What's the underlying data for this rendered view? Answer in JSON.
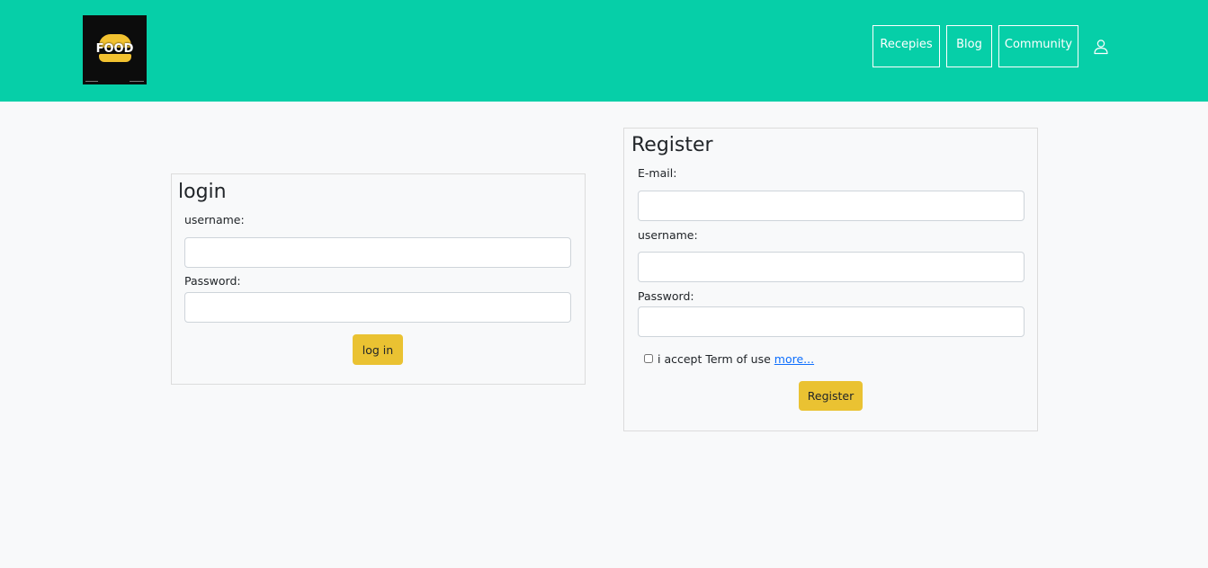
{
  "header": {
    "logo": {
      "text": "FOOD",
      "icon": "burger-logo-icon"
    },
    "nav": [
      {
        "label": "Recepies"
      },
      {
        "label": "Blog"
      },
      {
        "label": "Community"
      }
    ],
    "user_icon": "user-icon",
    "colors": {
      "bar": "#06cfa8"
    }
  },
  "login": {
    "title": "login",
    "username_label": "username:",
    "username_value": "",
    "password_label": "Password:",
    "password_value": "",
    "submit_label": "log in"
  },
  "register": {
    "title": "Register",
    "email_label": "E-mail:",
    "email_value": "",
    "username_label": "username:",
    "username_value": "",
    "password_label": "Password:",
    "password_value": "",
    "terms_text": "i accept Term of use",
    "terms_link": "more...",
    "terms_checked": false,
    "submit_label": "Register"
  },
  "colors": {
    "button": "#eac232",
    "link": "#0d6efd"
  }
}
